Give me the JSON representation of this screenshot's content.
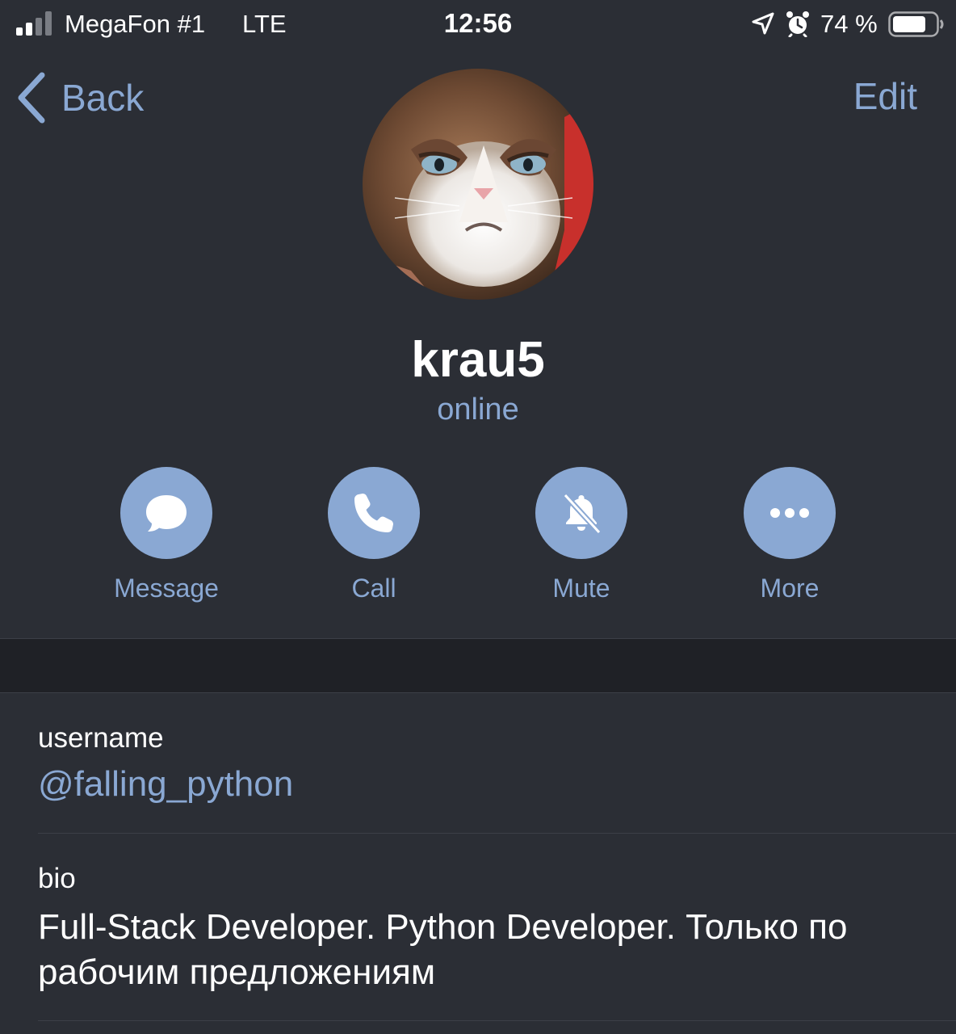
{
  "status_bar": {
    "carrier": "MegaFon #1",
    "network": "LTE",
    "time": "12:56",
    "battery": "74 %",
    "signal_bars": 4,
    "signal_active": 2,
    "icons": [
      "signal-icon",
      "location-arrow-icon",
      "alarm-clock-icon",
      "battery-icon"
    ]
  },
  "nav": {
    "back_label": "Back",
    "edit_label": "Edit"
  },
  "profile": {
    "name": "krau5",
    "status": "online"
  },
  "actions": [
    {
      "label": "Message",
      "icon": "message-bubble-icon"
    },
    {
      "label": "Call",
      "icon": "phone-icon"
    },
    {
      "label": "Mute",
      "icon": "bell-muted-icon"
    },
    {
      "label": "More",
      "icon": "more-dots-icon"
    }
  ],
  "info": {
    "username_label": "username",
    "username_value": "@falling_python",
    "bio_label": "bio",
    "bio_value": "Full-Stack Developer. Python Developer. Только по рабочим предложениям"
  },
  "colors": {
    "background": "#2b2e35",
    "accent": "#8aa8d3",
    "section_gap": "#1f2126",
    "separator": "#3c3f47"
  }
}
